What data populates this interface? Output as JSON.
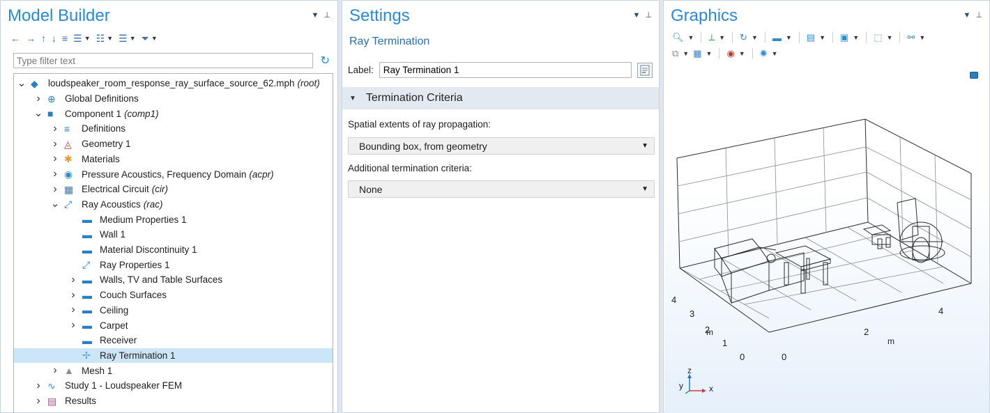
{
  "model_builder": {
    "title": "Model Builder",
    "filter_placeholder": "Type filter text",
    "tree": [
      {
        "label": "loudspeaker_room_response_ray_surface_source_62.mph",
        "suffix": "(root)",
        "icon": "model-root-icon",
        "caret": "expanded"
      },
      {
        "label": "Global Definitions",
        "suffix": "",
        "icon": "globe-icon",
        "caret": "collapsed"
      },
      {
        "label": "Component 1",
        "suffix": "(comp1)",
        "icon": "component-icon",
        "caret": "expanded"
      },
      {
        "label": "Definitions",
        "suffix": "",
        "icon": "definitions-icon",
        "caret": "collapsed"
      },
      {
        "label": "Geometry 1",
        "suffix": "",
        "icon": "geometry-icon",
        "caret": "collapsed"
      },
      {
        "label": "Materials",
        "suffix": "",
        "icon": "materials-icon",
        "caret": "collapsed"
      },
      {
        "label": "Pressure Acoustics, Frequency Domain",
        "suffix": "(acpr)",
        "icon": "pressure-acoustics-icon",
        "caret": "collapsed"
      },
      {
        "label": "Electrical Circuit",
        "suffix": "(cir)",
        "icon": "electrical-circuit-icon",
        "caret": "collapsed"
      },
      {
        "label": "Ray Acoustics",
        "suffix": "(rac)",
        "icon": "ray-acoustics-icon",
        "caret": "expanded"
      },
      {
        "label": "Medium Properties 1",
        "suffix": "",
        "icon": "domain-feature-icon",
        "caret": "none"
      },
      {
        "label": "Wall 1",
        "suffix": "",
        "icon": "domain-feature-icon",
        "caret": "none"
      },
      {
        "label": "Material Discontinuity 1",
        "suffix": "",
        "icon": "domain-feature-icon",
        "caret": "none"
      },
      {
        "label": "Ray Properties 1",
        "suffix": "",
        "icon": "ray-properties-icon",
        "caret": "none"
      },
      {
        "label": "Walls, TV and Table Surfaces",
        "suffix": "",
        "icon": "boundary-feature-icon",
        "caret": "collapsed"
      },
      {
        "label": "Couch Surfaces",
        "suffix": "",
        "icon": "boundary-feature-icon",
        "caret": "collapsed"
      },
      {
        "label": "Ceiling",
        "suffix": "",
        "icon": "boundary-feature-icon",
        "caret": "collapsed"
      },
      {
        "label": "Carpet",
        "suffix": "",
        "icon": "boundary-feature-icon",
        "caret": "collapsed"
      },
      {
        "label": "Receiver",
        "suffix": "",
        "icon": "boundary-feature-icon",
        "caret": "none"
      },
      {
        "label": "Ray Termination 1",
        "suffix": "",
        "icon": "ray-termination-icon",
        "caret": "none",
        "selected": true
      },
      {
        "label": "Mesh 1",
        "suffix": "",
        "icon": "mesh-icon",
        "caret": "collapsed"
      },
      {
        "label": "Study 1 - Loudspeaker FEM",
        "suffix": "",
        "icon": "study-icon",
        "caret": "collapsed"
      },
      {
        "label": "Results",
        "suffix": "",
        "icon": "results-icon",
        "caret": "collapsed"
      }
    ]
  },
  "settings": {
    "title": "Settings",
    "subtitle": "Ray Termination",
    "label_caption": "Label:",
    "label_value": "Ray Termination 1",
    "section_title": "Termination Criteria",
    "spatial_label": "Spatial extents of ray propagation:",
    "spatial_value": "Bounding box, from geometry",
    "additional_label": "Additional termination criteria:",
    "additional_value": "None"
  },
  "graphics": {
    "title": "Graphics",
    "ticks_x": [
      "0",
      "2",
      "4"
    ],
    "ticks_y": [
      "0",
      "1",
      "2",
      "3",
      "4"
    ],
    "unit_x": "m",
    "unit_y": "m",
    "axis_x": "x",
    "axis_y": "y",
    "axis_z": "z"
  },
  "colors": {
    "title_blue": "#2a8ad4",
    "selected_row": "#cde6f7",
    "section_bar": "#e3e9f0"
  }
}
